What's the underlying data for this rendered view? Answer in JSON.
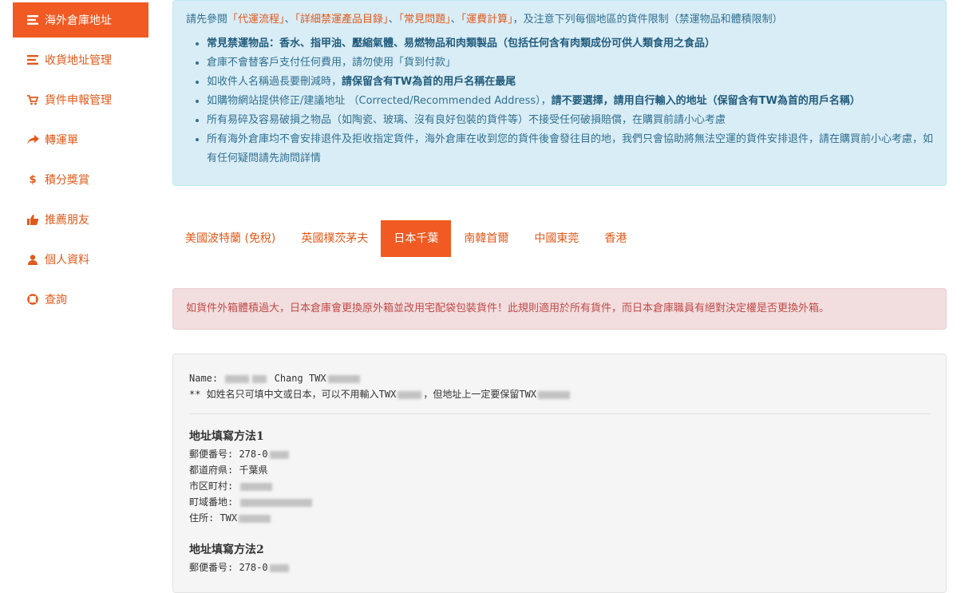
{
  "sidebar": {
    "items": [
      {
        "label": "海外倉庫地址",
        "icon": "list-icon",
        "active": true
      },
      {
        "label": "收貨地址管理",
        "icon": "list-icon",
        "active": false
      },
      {
        "label": "貨件申報管理",
        "icon": "cart-icon",
        "active": false
      },
      {
        "label": "轉運單",
        "icon": "share-arrow-icon",
        "active": false
      },
      {
        "label": "積分獎賞",
        "icon": "dollar-icon",
        "active": false
      },
      {
        "label": "推薦朋友",
        "icon": "thumbs-up-icon",
        "active": false
      },
      {
        "label": "個人資料",
        "icon": "user-icon",
        "active": false
      },
      {
        "label": "查詢",
        "icon": "lifebuoy-icon",
        "active": false
      }
    ]
  },
  "info": {
    "intro_prefix": "請先參閱",
    "links": [
      "「代運流程」",
      "「詳細禁運產品目錄」",
      "「常見問題」",
      "「運費計算」"
    ],
    "sep": "、",
    "intro_suffix": "，及注意下列每個地區的貨件限制（禁運物品和體積限制）",
    "bullets": {
      "b1": "常見禁運物品：香水、指甲油、壓縮氣體、易燃物品和肉類製品（包括任何含有肉類成份可供人類食用之食品）",
      "b2": "倉庫不會替客戶支付任何費用，請勿使用「貨到付款」",
      "b3_a": "如收件人名稱過長要刪減時，",
      "b3_b": "請保留含有TW為首的用戶名稱在最尾",
      "b4_a": "如購物網站提供修正/建議地址 （Corrected/Recommended Address），",
      "b4_b": "請不要選擇，請用自行輸入的地址（保留含有TW為首的用戶名稱）",
      "b5": "所有易碎及容易破損之物品（如陶瓷、玻璃、沒有良好包裝的貨件等）不接受任何破損賠償，在購買前請小心考慮",
      "b6": "所有海外倉庫均不會安排退件及拒收指定貨件，海外倉庫在收到您的貨件後會發往目的地，我們只會協助將無法空運的貨件安排退件，請在購買前小心考慮，如有任何疑問請先詢問詳情"
    }
  },
  "tabs": [
    {
      "label": "美國波特蘭 (免稅)",
      "active": false
    },
    {
      "label": "英國樸茨茅夫",
      "active": false
    },
    {
      "label": "日本千葉",
      "active": true
    },
    {
      "label": "南韓首爾",
      "active": false
    },
    {
      "label": "中國東莞",
      "active": false
    },
    {
      "label": "香港",
      "active": false
    }
  ],
  "warning": "如貨件外箱體積過大，日本倉庫會更換原外箱並改用宅配袋包裝貨件！此規則適用於所有貨件，而日本倉庫職員有絕對決定權是否更換外箱。",
  "address": {
    "name_label": "Name: ",
    "name_mid": "Chang TWX",
    "note_a": "** 如姓名只可填中文或日本，可以不用輸入TWX",
    "note_b": "，但地址上一定要保留TWX",
    "method1": {
      "title": "地址填寫方法1",
      "postal_label": "郵便番号: ",
      "postal_value": "278-0",
      "pref_label": "都道府県: ",
      "pref_value": "千葉県",
      "city_label": "市区町村: ",
      "town_label": "町域番地: ",
      "addr_label": "住所: ",
      "addr_value": "TWX"
    },
    "method2": {
      "title": "地址填寫方法2",
      "postal_label": "郵便番号: ",
      "postal_value": "278-0"
    }
  }
}
